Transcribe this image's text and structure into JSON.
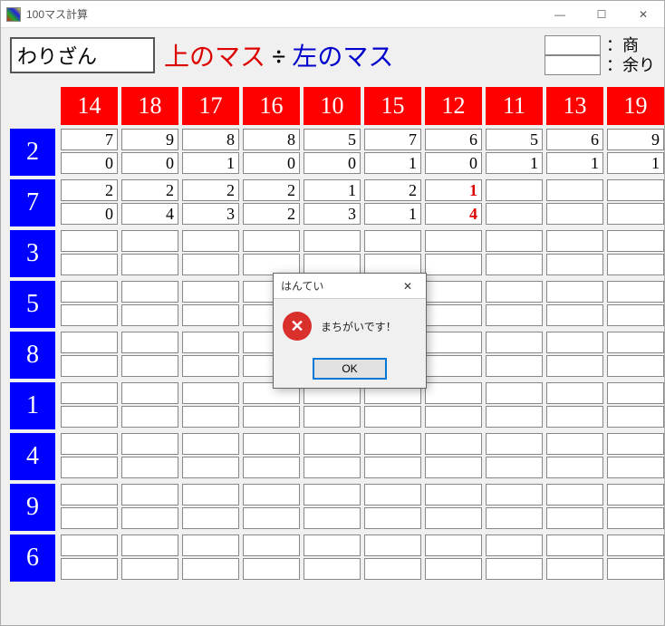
{
  "window": {
    "title": "100マス計算",
    "min": "—",
    "max": "☐",
    "close": "✕"
  },
  "header": {
    "mode": "わりざん",
    "formula_top": "上のマス",
    "formula_div": "÷",
    "formula_left": "左のマス",
    "legend_quotient": "：商",
    "legend_remainder": "：余り"
  },
  "columns": [
    "14",
    "18",
    "17",
    "16",
    "10",
    "15",
    "12",
    "11",
    "13",
    "19"
  ],
  "rows": [
    "2",
    "7",
    "3",
    "5",
    "8",
    "1",
    "4",
    "9",
    "6"
  ],
  "chart_data": {
    "type": "table",
    "title": "100マス計算 わりざん (上のマス ÷ 左のマス)",
    "col_headers": [
      14,
      18,
      17,
      16,
      10,
      15,
      12,
      11,
      13,
      19
    ],
    "row_headers": [
      2,
      7,
      3,
      5,
      8,
      1,
      4,
      9,
      6
    ],
    "legend": {
      "top_cell": "商 (quotient)",
      "bottom_cell": "余り (remainder)"
    },
    "cells": [
      [
        {
          "q": "7",
          "r": "0"
        },
        {
          "q": "9",
          "r": "0"
        },
        {
          "q": "8",
          "r": "1"
        },
        {
          "q": "8",
          "r": "0"
        },
        {
          "q": "5",
          "r": "0"
        },
        {
          "q": "7",
          "r": "1"
        },
        {
          "q": "6",
          "r": "0"
        },
        {
          "q": "5",
          "r": "1"
        },
        {
          "q": "6",
          "r": "1"
        },
        {
          "q": "9",
          "r": "1"
        }
      ],
      [
        {
          "q": "2",
          "r": "0"
        },
        {
          "q": "2",
          "r": "4"
        },
        {
          "q": "2",
          "r": "3"
        },
        {
          "q": "2",
          "r": "2"
        },
        {
          "q": "1",
          "r": "3"
        },
        {
          "q": "2",
          "r": "1"
        },
        {
          "q": "1",
          "r": "4",
          "wrong": true
        },
        {
          "q": "",
          "r": ""
        },
        {
          "q": "",
          "r": ""
        },
        {
          "q": "",
          "r": ""
        }
      ],
      [
        {
          "q": "",
          "r": ""
        },
        {
          "q": "",
          "r": ""
        },
        {
          "q": "",
          "r": ""
        },
        {
          "q": "",
          "r": ""
        },
        {
          "q": "",
          "r": ""
        },
        {
          "q": "",
          "r": ""
        },
        {
          "q": "",
          "r": ""
        },
        {
          "q": "",
          "r": ""
        },
        {
          "q": "",
          "r": ""
        },
        {
          "q": "",
          "r": ""
        }
      ],
      [
        {
          "q": "",
          "r": ""
        },
        {
          "q": "",
          "r": ""
        },
        {
          "q": "",
          "r": ""
        },
        {
          "q": "",
          "r": ""
        },
        {
          "q": "",
          "r": ""
        },
        {
          "q": "",
          "r": ""
        },
        {
          "q": "",
          "r": ""
        },
        {
          "q": "",
          "r": ""
        },
        {
          "q": "",
          "r": ""
        },
        {
          "q": "",
          "r": ""
        }
      ],
      [
        {
          "q": "",
          "r": ""
        },
        {
          "q": "",
          "r": ""
        },
        {
          "q": "",
          "r": ""
        },
        {
          "q": "",
          "r": ""
        },
        {
          "q": "",
          "r": ""
        },
        {
          "q": "",
          "r": ""
        },
        {
          "q": "",
          "r": ""
        },
        {
          "q": "",
          "r": ""
        },
        {
          "q": "",
          "r": ""
        },
        {
          "q": "",
          "r": ""
        }
      ],
      [
        {
          "q": "",
          "r": ""
        },
        {
          "q": "",
          "r": ""
        },
        {
          "q": "",
          "r": ""
        },
        {
          "q": "",
          "r": ""
        },
        {
          "q": "",
          "r": ""
        },
        {
          "q": "",
          "r": ""
        },
        {
          "q": "",
          "r": ""
        },
        {
          "q": "",
          "r": ""
        },
        {
          "q": "",
          "r": ""
        },
        {
          "q": "",
          "r": ""
        }
      ],
      [
        {
          "q": "",
          "r": ""
        },
        {
          "q": "",
          "r": ""
        },
        {
          "q": "",
          "r": ""
        },
        {
          "q": "",
          "r": ""
        },
        {
          "q": "",
          "r": ""
        },
        {
          "q": "",
          "r": ""
        },
        {
          "q": "",
          "r": ""
        },
        {
          "q": "",
          "r": ""
        },
        {
          "q": "",
          "r": ""
        },
        {
          "q": "",
          "r": ""
        }
      ],
      [
        {
          "q": "",
          "r": ""
        },
        {
          "q": "",
          "r": ""
        },
        {
          "q": "",
          "r": ""
        },
        {
          "q": "",
          "r": ""
        },
        {
          "q": "",
          "r": ""
        },
        {
          "q": "",
          "r": ""
        },
        {
          "q": "",
          "r": ""
        },
        {
          "q": "",
          "r": ""
        },
        {
          "q": "",
          "r": ""
        },
        {
          "q": "",
          "r": ""
        }
      ],
      [
        {
          "q": "",
          "r": ""
        },
        {
          "q": "",
          "r": ""
        },
        {
          "q": "",
          "r": ""
        },
        {
          "q": "",
          "r": ""
        },
        {
          "q": "",
          "r": ""
        },
        {
          "q": "",
          "r": ""
        },
        {
          "q": "",
          "r": ""
        },
        {
          "q": "",
          "r": ""
        },
        {
          "q": "",
          "r": ""
        },
        {
          "q": "",
          "r": ""
        }
      ]
    ]
  },
  "dialog": {
    "title": "はんてい",
    "close": "✕",
    "error_glyph": "✕",
    "message": "まちがいです！",
    "ok": "OK"
  }
}
